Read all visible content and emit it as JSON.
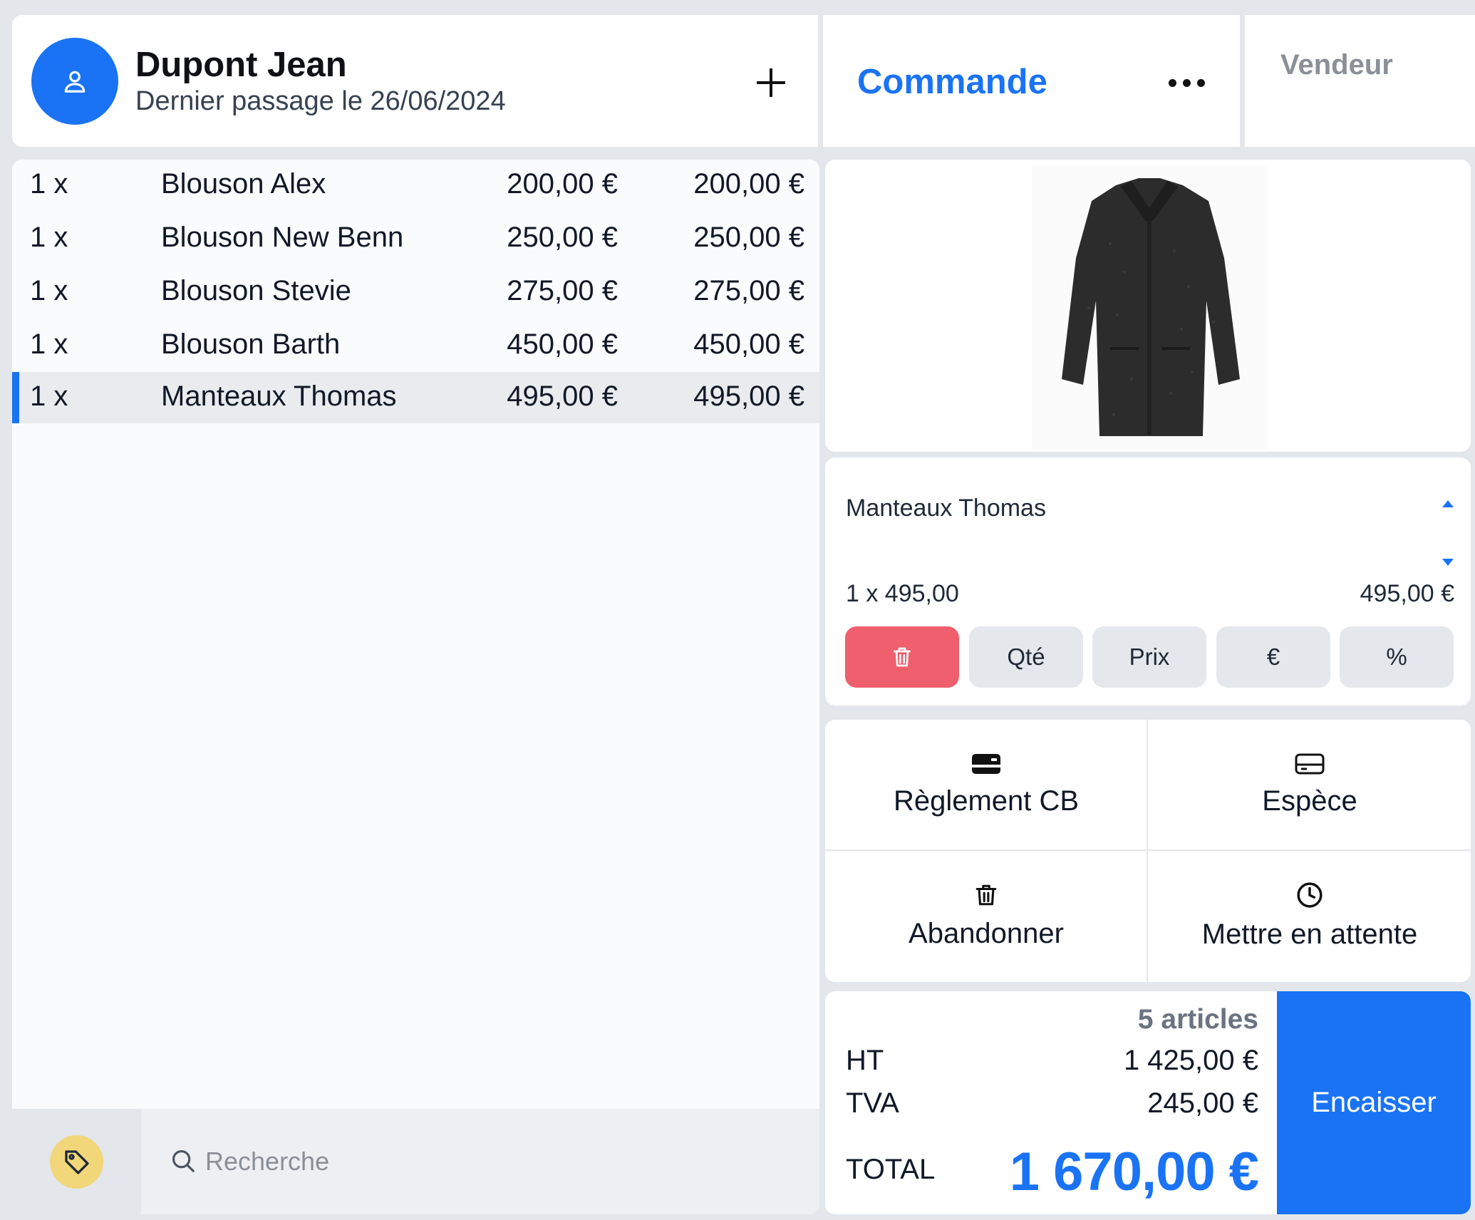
{
  "customer": {
    "name": "Dupont Jean",
    "last_visit": "Dernier passage le 26/06/2024"
  },
  "commande": {
    "title": "Commande"
  },
  "vendeur": {
    "label": "Vendeur"
  },
  "order_lines": [
    {
      "qty": "1 x",
      "name": "Blouson Alex",
      "price": "200,00 €",
      "total": "200,00 €"
    },
    {
      "qty": "1 x",
      "name": "Blouson New Benn",
      "price": "250,00 €",
      "total": "250,00 €"
    },
    {
      "qty": "1 x",
      "name": "Blouson Stevie",
      "price": "275,00 €",
      "total": "275,00 €"
    },
    {
      "qty": "1 x",
      "name": "Blouson Barth",
      "price": "450,00 €",
      "total": "450,00 €"
    },
    {
      "qty": "1 x",
      "name": "Manteaux Thomas",
      "price": "495,00 €",
      "total": "495,00 €",
      "selected": true
    }
  ],
  "search": {
    "placeholder": "Recherche"
  },
  "detail": {
    "name": "Manteaux Thomas",
    "qty_price": "1 x 495,00",
    "total": "495,00 €",
    "buttons": {
      "qty": "Qté",
      "price": "Prix",
      "euro": "€",
      "percent": "%"
    }
  },
  "actions": {
    "card": "Règlement CB",
    "cash": "Espèce",
    "abandon": "Abandonner",
    "hold": "Mettre en attente"
  },
  "totals": {
    "articles": "5 articles",
    "ht_label": "HT",
    "ht_value": "1 425,00 €",
    "tva_label": "TVA",
    "tva_value": "245,00 €",
    "total_label": "TOTAL",
    "total_value": "1 670,00 €",
    "checkout": "Encaisser"
  },
  "colors": {
    "accent": "#1a73f5",
    "delete": "#ef5f6d",
    "tag": "#f2d67a"
  }
}
